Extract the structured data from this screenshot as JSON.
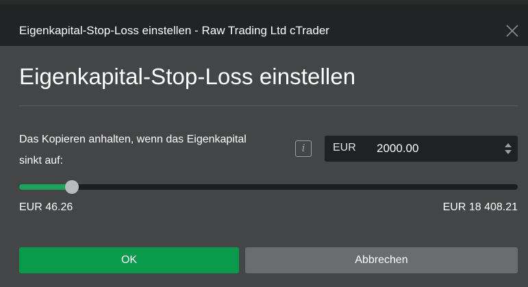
{
  "window": {
    "title": "Eigenkapital-Stop-Loss einstellen - Raw Trading Ltd cTrader",
    "close_icon": "close-icon"
  },
  "dialog": {
    "heading": "Eigenkapital-Stop-Loss einstellen",
    "prompt": "Das Kopieren anhalten, wenn das Eigenkapital sinkt auf:",
    "info_icon": "info-icon",
    "info_glyph": "i",
    "amount": {
      "currency": "EUR",
      "value": "2000.00",
      "spinner_icon": "spinner-arrows-icon"
    },
    "slider": {
      "min_label": "EUR 46.26",
      "max_label": "EUR 18 408.21",
      "min": 46.26,
      "max": 18408.21,
      "value": 2000.0
    },
    "buttons": {
      "ok": "OK",
      "cancel": "Abbrechen"
    }
  },
  "colors": {
    "accent": "#0a9a4b",
    "slider_fill": "#1ba45a",
    "background": "#444546",
    "titlebar": "#222324"
  }
}
